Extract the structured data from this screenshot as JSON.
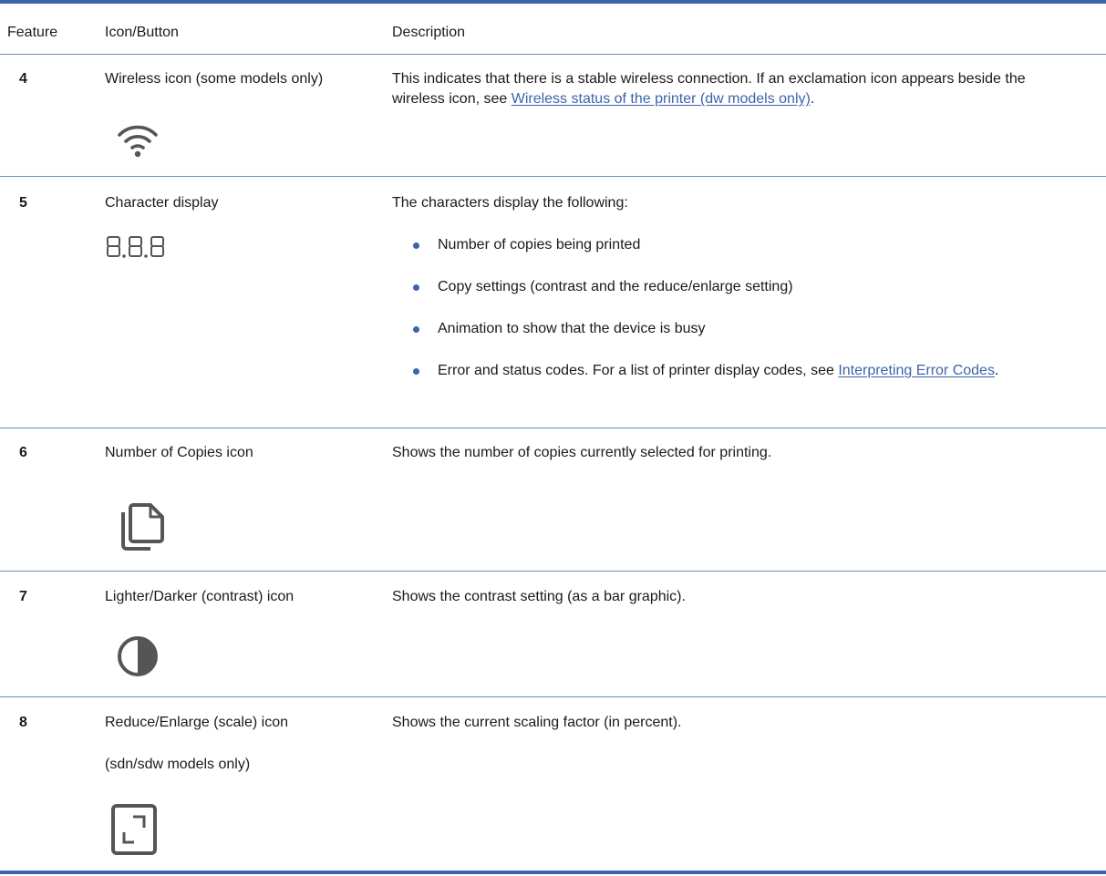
{
  "table": {
    "headers": {
      "feature": "Feature",
      "icon_button": "Icon/Button",
      "description": "Description"
    },
    "rows": [
      {
        "feature": "4",
        "name": "Wireless icon (some models only)",
        "icon": "wifi-icon",
        "desc_pre": "This indicates that there is a stable wireless connection. If an exclamation icon appears beside the wireless icon, see ",
        "desc_link": "Wireless status of the printer (dw models only)",
        "desc_post": "."
      },
      {
        "feature": "5",
        "name": "Character display",
        "icon": "seven-segment-display-icon",
        "desc_intro": "The characters display the following:",
        "bullets": [
          "Number of copies being printed",
          "Copy settings (contrast and the reduce/enlarge setting)",
          "Animation to show that the device is busy"
        ],
        "last_bullet_pre": "Error and status codes. For a list of printer display codes, see ",
        "last_bullet_link": "Interpreting Error Codes",
        "last_bullet_post": "."
      },
      {
        "feature": "6",
        "name": "Number of Copies icon",
        "icon": "copies-icon",
        "desc": "Shows the number of copies currently selected for printing."
      },
      {
        "feature": "7",
        "name": "Lighter/Darker (contrast) icon",
        "icon": "contrast-icon",
        "desc": "Shows the contrast setting (as a bar graphic)."
      },
      {
        "feature": "8",
        "name": "Reduce/Enlarge (scale) icon",
        "name_note": "(sdn/sdw models only)",
        "icon": "scale-icon",
        "desc": "Shows the current scaling factor (in percent)."
      }
    ]
  },
  "colors": {
    "rule": "#3c64ac",
    "link": "#3c64ac",
    "icon": "#555555"
  }
}
